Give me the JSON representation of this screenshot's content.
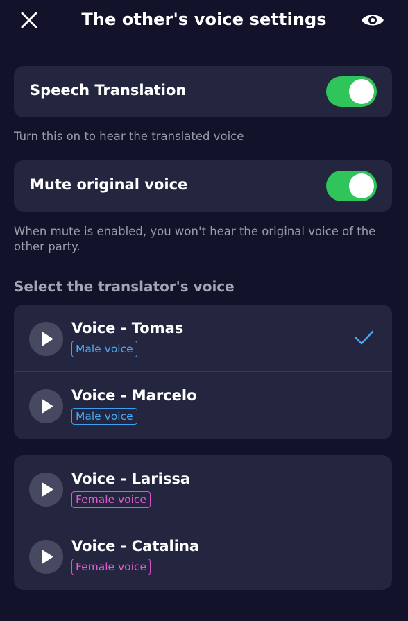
{
  "header": {
    "title": "The other's voice settings",
    "close_icon": "close-icon",
    "eye_icon": "eye-icon"
  },
  "settings": {
    "speech_translation": {
      "label": "Speech Translation",
      "enabled": true,
      "hint": "Turn this on to hear the translated voice"
    },
    "mute_original": {
      "label": "Mute original voice",
      "enabled": true,
      "hint": "When mute is enabled, you won't hear the original voice of the other party."
    }
  },
  "voices": {
    "section_title": "Select the translator's voice",
    "male": [
      {
        "name": "Voice - Tomas",
        "tag": "Male voice",
        "selected": true
      },
      {
        "name": "Voice - Marcelo",
        "tag": "Male voice",
        "selected": false
      }
    ],
    "female": [
      {
        "name": "Voice - Larissa",
        "tag": "Female voice",
        "selected": false
      },
      {
        "name": "Voice - Catalina",
        "tag": "Female voice",
        "selected": false
      }
    ]
  },
  "colors": {
    "background": "#12132b",
    "card": "#24263f",
    "toggle_on": "#2fc55a",
    "male_tag": "#3c9ff0",
    "female_tag": "#e04fcb",
    "check": "#4aa9f5"
  }
}
